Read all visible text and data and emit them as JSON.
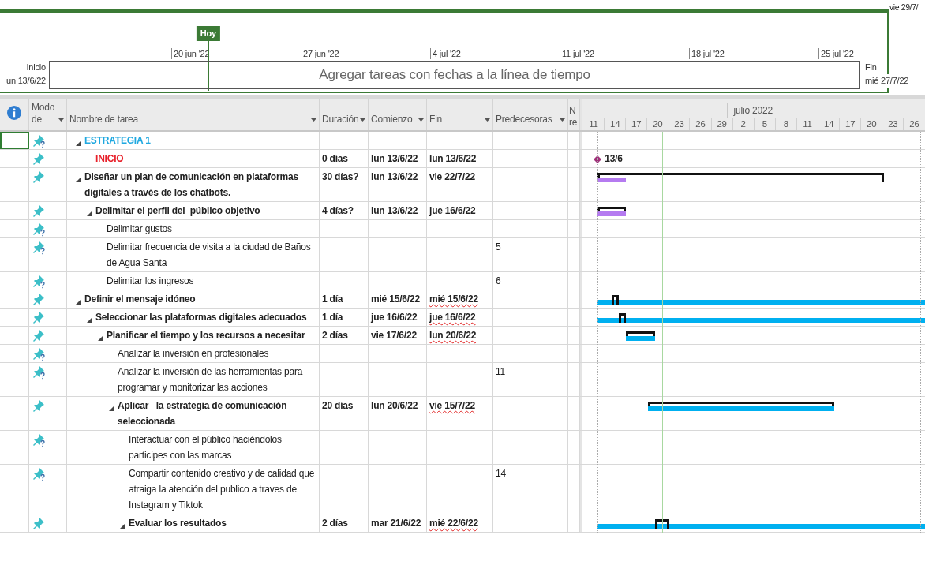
{
  "timeline": {
    "corner_date": "vie 29/7/",
    "today_label": "Hoy",
    "ticks": [
      "20 jun '22",
      "27 jun '22",
      "4 jul '22",
      "11 jul '22",
      "18 jul '22",
      "25 jul '22"
    ],
    "start_label": "Inicio",
    "start_date": "un 13/6/22",
    "finish_label": "Fin",
    "finish_date": "mié 27/7/22",
    "placeholder": "Agregar tareas con fechas a la línea de tiempo"
  },
  "table": {
    "columns": [
      {
        "label": "Modo de",
        "filter": true
      },
      {
        "label": "Nombre de tarea",
        "filter": true
      },
      {
        "label": "Duración",
        "filter": true
      },
      {
        "label": "Comienzo",
        "filter": true
      },
      {
        "label": "Fin",
        "filter": true
      },
      {
        "label": "Predecesoras",
        "filter": true
      },
      {
        "label": "N re",
        "filter": false
      }
    ]
  },
  "gantt": {
    "month": "julio 2022",
    "days": [
      "11",
      "14",
      "17",
      "20",
      "23",
      "26",
      "29",
      "2",
      "5",
      "8",
      "11",
      "14",
      "17",
      "20",
      "23",
      "26"
    ]
  },
  "tasks": [
    {
      "name": "ESTRATEGIA 1",
      "unscheduled": true,
      "bold": true,
      "color": "#1fa8e0",
      "selected": true,
      "expanded": true,
      "children": [
        {
          "name": "INICIO",
          "unscheduled": false,
          "bold": true,
          "color": "#e8202a",
          "selected": false,
          "duration": "0 días",
          "start": "lun 13/6/22",
          "finish": "lun 13/6/22",
          "finish_flag": false,
          "bars": [
            {
              "kind": "milestone",
              "label": "13/6",
              "color": "#a0307a"
            }
          ]
        }
      ]
    },
    {
      "name": "Diseñar un plan de comunicación en plataformas digitales a través de los chatbots.",
      "unscheduled": false,
      "bold": true,
      "selected": false,
      "expanded": true,
      "duration": "30 días?",
      "start": "lun 13/6/22",
      "finish": "vie 22/7/22",
      "finish_flag": false,
      "bars": [
        {
          "kind": "summary"
        },
        {
          "kind": "rollup",
          "color": "#b57bf0"
        }
      ],
      "children": [
        {
          "name": "Delimitar el perfil del  público objetivo",
          "unscheduled": false,
          "bold": true,
          "selected": false,
          "expanded": true,
          "duration": "4 días?",
          "start": "lun 13/6/22",
          "finish": "jue 16/6/22",
          "finish_flag": false,
          "bars": [
            {
              "kind": "summary"
            },
            {
              "kind": "task",
              "color": "#b57bf0"
            }
          ],
          "children": [
            {
              "name": "Delimitar gustos",
              "unscheduled": true,
              "bold": false,
              "selected": false
            },
            {
              "name": "Delimitar frecuencia de visita a la ciudad de Baños de Agua Santa",
              "unscheduled": true,
              "bold": false,
              "selected": false,
              "predecessors": "5"
            },
            {
              "name": "Delimitar los ingresos",
              "unscheduled": true,
              "bold": false,
              "selected": false,
              "predecessors": "6"
            }
          ]
        }
      ]
    },
    {
      "name": "Definir el mensaje idóneo",
      "unscheduled": false,
      "bold": true,
      "selected": false,
      "expanded": true,
      "duration": "1 día",
      "start": "mié 15/6/22",
      "finish": "mié 15/6/22",
      "finish_flag": true,
      "bars": [
        {
          "kind": "band",
          "color": "#00b0f0"
        },
        {
          "kind": "summary"
        }
      ],
      "children": [
        {
          "name": "Seleccionar las plataformas digitales adecuados",
          "unscheduled": false,
          "bold": true,
          "selected": false,
          "expanded": true,
          "duration": "1 día",
          "start": "jue 16/6/22",
          "finish": "jue 16/6/22",
          "finish_flag": true,
          "bars": [
            {
              "kind": "band",
              "color": "#00b0f0"
            },
            {
              "kind": "summary"
            }
          ],
          "children": [
            {
              "name": "Planificar el tiempo y los recursos a necesitar",
              "unscheduled": false,
              "bold": true,
              "selected": false,
              "expanded": true,
              "duration": "2 días",
              "start": "vie 17/6/22",
              "finish": "lun 20/6/22",
              "finish_flag": true,
              "bars": [
                {
                  "kind": "summary"
                },
                {
                  "kind": "task",
                  "color": "#00b0f0"
                }
              ],
              "children": [
                {
                  "name": "Analizar la inversión en profesionales",
                  "unscheduled": true,
                  "bold": false,
                  "selected": false
                },
                {
                  "name": "Analizar la inversión de las herramientas para programar y monitorizar las acciones",
                  "unscheduled": true,
                  "bold": false,
                  "selected": false,
                  "predecessors": "11"
                },
                {
                  "name": "Aplicar   la estrategia de comunicación seleccionada",
                  "unscheduled": false,
                  "bold": true,
                  "selected": false,
                  "expanded": true,
                  "duration": "20 días",
                  "start": "lun 20/6/22",
                  "finish": "vie 15/7/22",
                  "finish_flag": true,
                  "bars": [
                    {
                      "kind": "summary"
                    },
                    {
                      "kind": "task",
                      "color": "#00b0f0"
                    }
                  ],
                  "children": [
                    {
                      "name": "Interactuar con el público haciéndolos participes con las marcas",
                      "unscheduled": true,
                      "bold": false,
                      "selected": false
                    },
                    {
                      "name": "Compartir contenido creativo y de calidad que atraiga la atención del publico a traves de Instagram y Tiktok",
                      "unscheduled": true,
                      "bold": false,
                      "selected": false,
                      "predecessors": "14"
                    },
                    {
                      "name": "Evaluar los resultados",
                      "unscheduled": false,
                      "bold": true,
                      "selected": false,
                      "expanded": true,
                      "duration": "2 días",
                      "start": "mar 21/6/22",
                      "finish": "mié 22/6/22",
                      "finish_flag": true,
                      "bars": [
                        {
                          "kind": "band",
                          "color": "#00b0f0"
                        },
                        {
                          "kind": "summary"
                        }
                      ]
                    }
                  ]
                }
              ]
            }
          ]
        }
      ]
    }
  ]
}
